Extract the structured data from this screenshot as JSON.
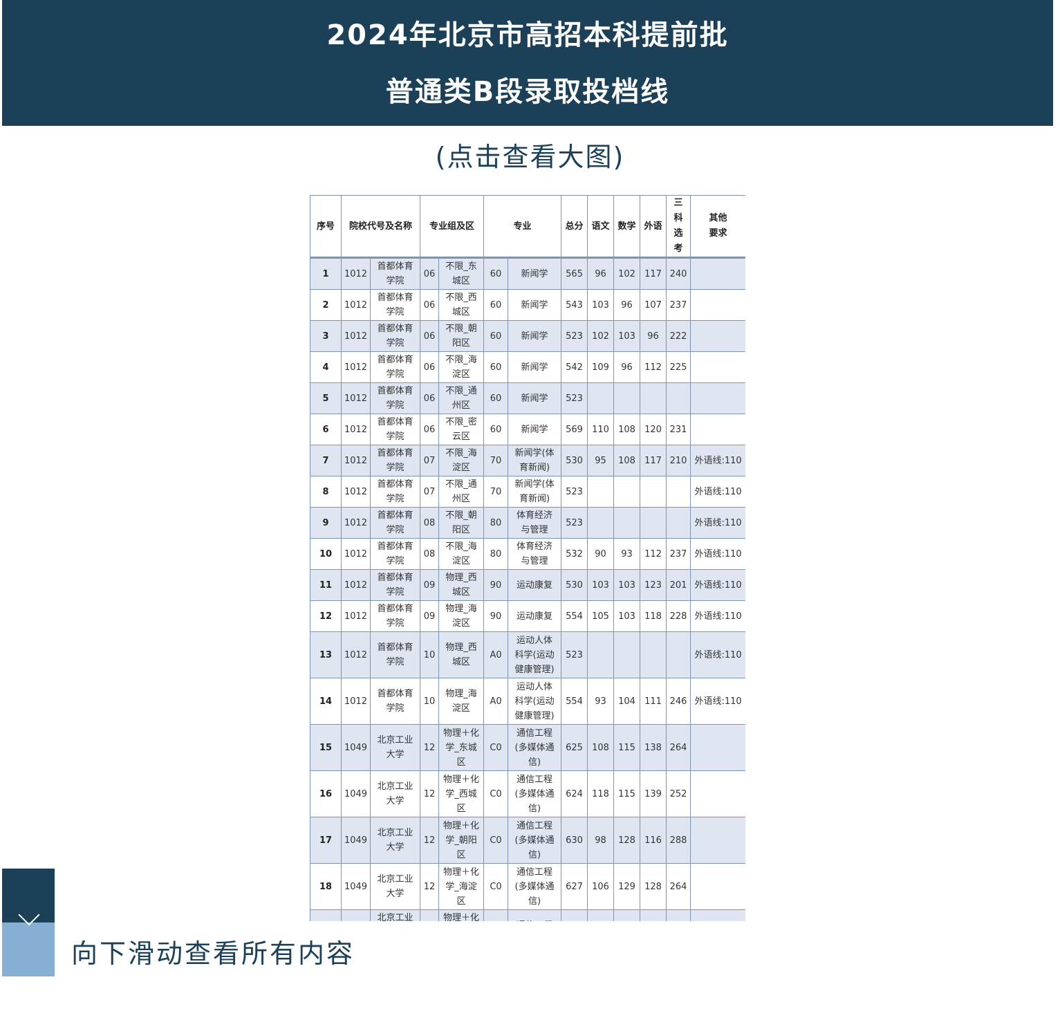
{
  "header": {
    "title_line1": "2024年北京市高招本科提前批",
    "title_line2": "普通类B段录取投档线"
  },
  "hint": "(点击查看大图)",
  "table": {
    "headers": {
      "seq": "序号",
      "school": "院校代号及名称",
      "group": "专业组及区",
      "major": "专业",
      "total": "总分",
      "chinese": "语文",
      "math": "数学",
      "foreign": "外语",
      "three": "三\n科\n选\n考",
      "other": "其他\n要求"
    },
    "rows": [
      [
        "1",
        "1012",
        "首都体育\n学院",
        "06",
        "不限_东\n城区",
        "60",
        "新闻学",
        "565",
        "96",
        "102",
        "117",
        "240",
        ""
      ],
      [
        "2",
        "1012",
        "首都体育\n学院",
        "06",
        "不限_西\n城区",
        "60",
        "新闻学",
        "543",
        "103",
        "96",
        "107",
        "237",
        ""
      ],
      [
        "3",
        "1012",
        "首都体育\n学院",
        "06",
        "不限_朝\n阳区",
        "60",
        "新闻学",
        "523",
        "102",
        "103",
        "96",
        "222",
        ""
      ],
      [
        "4",
        "1012",
        "首都体育\n学院",
        "06",
        "不限_海\n淀区",
        "60",
        "新闻学",
        "542",
        "109",
        "96",
        "112",
        "225",
        ""
      ],
      [
        "5",
        "1012",
        "首都体育\n学院",
        "06",
        "不限_通\n州区",
        "60",
        "新闻学",
        "523",
        "",
        "",
        "",
        "",
        ""
      ],
      [
        "6",
        "1012",
        "首都体育\n学院",
        "06",
        "不限_密\n云区",
        "60",
        "新闻学",
        "569",
        "110",
        "108",
        "120",
        "231",
        ""
      ],
      [
        "7",
        "1012",
        "首都体育\n学院",
        "07",
        "不限_海\n淀区",
        "70",
        "新闻学(体\n育新闻)",
        "530",
        "95",
        "108",
        "117",
        "210",
        "外语线:110"
      ],
      [
        "8",
        "1012",
        "首都体育\n学院",
        "07",
        "不限_通\n州区",
        "70",
        "新闻学(体\n育新闻)",
        "523",
        "",
        "",
        "",
        "",
        "外语线:110"
      ],
      [
        "9",
        "1012",
        "首都体育\n学院",
        "08",
        "不限_朝\n阳区",
        "80",
        "体育经济\n与管理",
        "523",
        "",
        "",
        "",
        "",
        "外语线:110"
      ],
      [
        "10",
        "1012",
        "首都体育\n学院",
        "08",
        "不限_海\n淀区",
        "80",
        "体育经济\n与管理",
        "532",
        "90",
        "93",
        "112",
        "237",
        "外语线:110"
      ],
      [
        "11",
        "1012",
        "首都体育\n学院",
        "09",
        "物理_西\n城区",
        "90",
        "运动康复",
        "530",
        "103",
        "103",
        "123",
        "201",
        "外语线:110"
      ],
      [
        "12",
        "1012",
        "首都体育\n学院",
        "09",
        "物理_海\n淀区",
        "90",
        "运动康复",
        "554",
        "105",
        "103",
        "118",
        "228",
        "外语线:110"
      ],
      [
        "13",
        "1012",
        "首都体育\n学院",
        "10",
        "物理_西\n城区",
        "A0",
        "运动人体\n科学(运动\n健康管理)",
        "523",
        "",
        "",
        "",
        "",
        "外语线:110"
      ],
      [
        "14",
        "1012",
        "首都体育\n学院",
        "10",
        "物理_海\n淀区",
        "A0",
        "运动人体\n科学(运动\n健康管理)",
        "554",
        "93",
        "104",
        "111",
        "246",
        "外语线:110"
      ],
      [
        "15",
        "1049",
        "北京工业\n大学",
        "12",
        "物理＋化\n学_东城\n区",
        "C0",
        "通信工程\n(多媒体通\n信)",
        "625",
        "108",
        "115",
        "138",
        "264",
        ""
      ],
      [
        "16",
        "1049",
        "北京工业\n大学",
        "12",
        "物理＋化\n学_西城\n区",
        "C0",
        "通信工程\n(多媒体通\n信)",
        "624",
        "118",
        "115",
        "139",
        "252",
        ""
      ],
      [
        "17",
        "1049",
        "北京工业\n大学",
        "12",
        "物理＋化\n学_朝阳\n区",
        "C0",
        "通信工程\n(多媒体通\n信)",
        "630",
        "98",
        "128",
        "116",
        "288",
        ""
      ],
      [
        "18",
        "1049",
        "北京工业\n大学",
        "12",
        "物理＋化\n学_海淀\n区",
        "C0",
        "通信工程\n(多媒体通\n信)",
        "627",
        "106",
        "129",
        "128",
        "264",
        ""
      ],
      [
        "",
        "",
        "北京工业\n大学",
        "",
        "物理＋化\n学",
        "",
        "通信工程",
        "",
        "",
        "",
        "",
        "",
        ""
      ]
    ]
  },
  "scroll_hint": {
    "text": "向下滑动查看所有内容",
    "icon": "chevron-down-icon"
  },
  "colors": {
    "header_bg": "#1c4058",
    "accent_light": "#86b0d3",
    "row_stripe": "#dfe6f2",
    "table_border": "#7c93b5"
  }
}
